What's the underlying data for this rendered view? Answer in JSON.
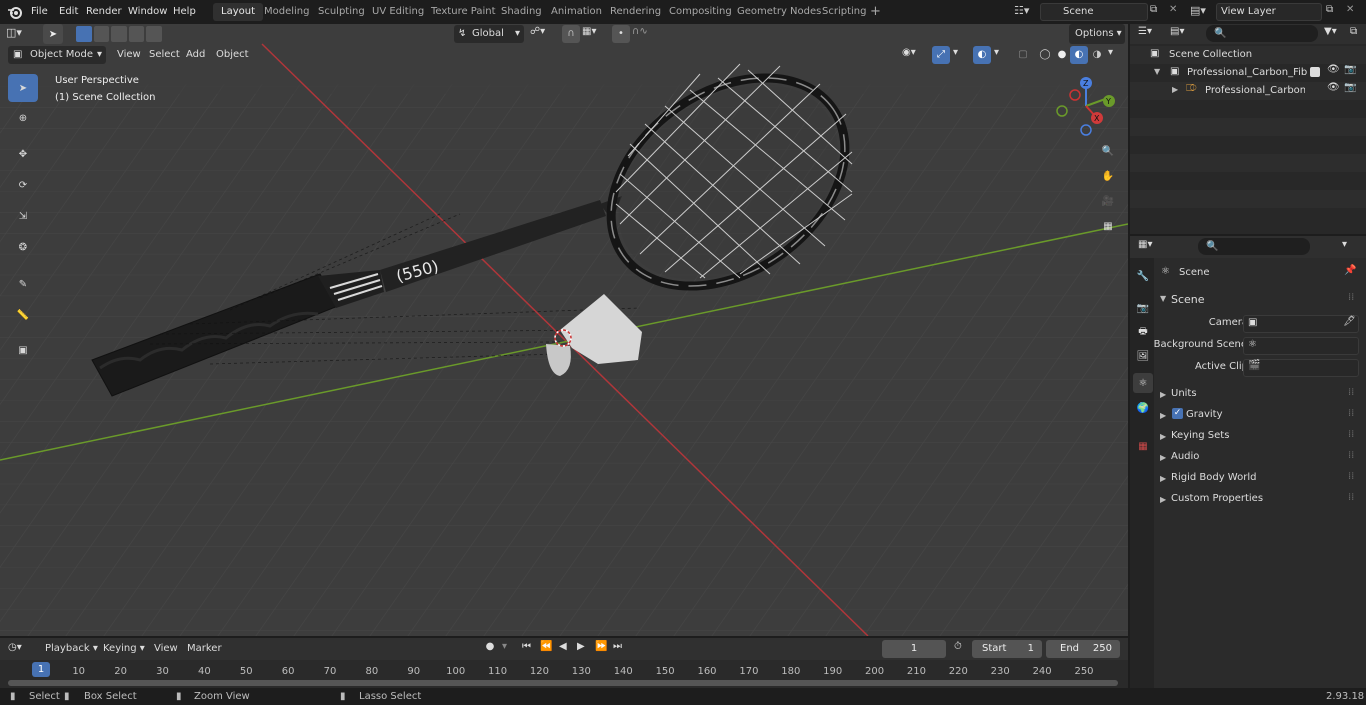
{
  "topbar": {
    "menus": [
      "File",
      "Edit",
      "Render",
      "Window",
      "Help"
    ],
    "workspaces": [
      "Layout",
      "Modeling",
      "Sculpting",
      "UV Editing",
      "Texture Paint",
      "Shading",
      "Animation",
      "Rendering",
      "Compositing",
      "Geometry Nodes",
      "Scripting"
    ],
    "active_workspace": "Layout",
    "add_tab": "+",
    "scene_name": "Scene",
    "view_layer": "View Layer"
  },
  "viewport": {
    "mode": "Object Mode",
    "menus": [
      "View",
      "Select",
      "Add",
      "Object"
    ],
    "transform_orientation": "Global",
    "options_label": "Options",
    "overlay_title": "User Perspective",
    "overlay_collection": "(1) Scene Collection",
    "racket_text": "(550)",
    "gizmo_axes": {
      "x": "X",
      "y": "Y",
      "z": "Z"
    }
  },
  "outliner": {
    "root": "Scene Collection",
    "items": [
      "Professional_Carbon_Fiber_Ba",
      "Professional_Carbon_Fibe"
    ]
  },
  "properties": {
    "context_title": "Scene",
    "panel_title": "Scene",
    "fields": [
      {
        "label": "Camera",
        "value": ""
      },
      {
        "label": "Background Scene",
        "value": ""
      },
      {
        "label": "Active Clip",
        "value": ""
      }
    ],
    "sections": [
      "Units",
      "Gravity",
      "Keying Sets",
      "Audio",
      "Rigid Body World",
      "Custom Properties"
    ],
    "gravity_checked": true
  },
  "timeline": {
    "menus": [
      "Playback",
      "Keying",
      "View",
      "Marker"
    ],
    "current_frame": "1",
    "start_label": "Start",
    "start": "1",
    "end_label": "End",
    "end": "250",
    "ticks": [
      "1",
      "10",
      "20",
      "30",
      "40",
      "50",
      "60",
      "70",
      "80",
      "90",
      "100",
      "110",
      "120",
      "130",
      "140",
      "150",
      "160",
      "170",
      "180",
      "190",
      "200",
      "210",
      "220",
      "230",
      "240",
      "250"
    ]
  },
  "statusbar": {
    "hints": [
      "Select",
      "Box Select",
      "Zoom View",
      "Lasso Select"
    ],
    "version": "2.93.18"
  },
  "colors": {
    "accent": "#4772b3",
    "x_axis": "#b0363a",
    "y_axis": "#6a9a2a",
    "viewport_bg": "#3d3d3d"
  }
}
